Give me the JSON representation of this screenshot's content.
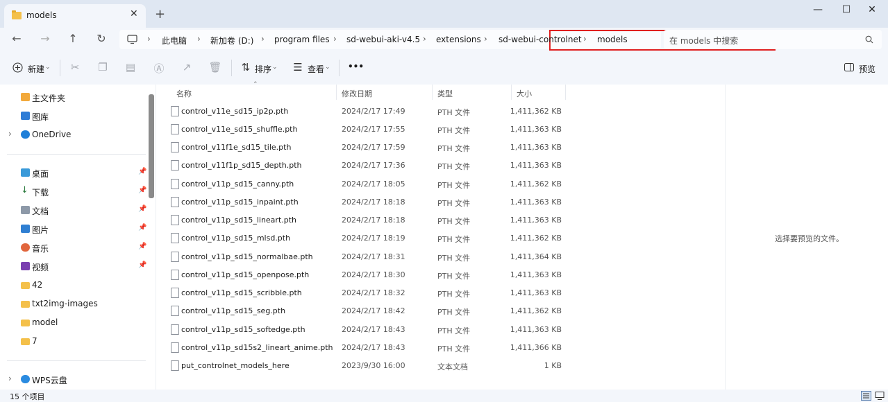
{
  "tab": {
    "title": "models",
    "close": "✕",
    "new": "+"
  },
  "window": {
    "minimize": "—",
    "maximize": "☐",
    "close": "✕"
  },
  "nav": {
    "back": "←",
    "forward": "→",
    "up": "↑",
    "refresh": "↻"
  },
  "breadcrumb": [
    "此电脑",
    "新加卷 (D:)",
    "program files",
    "sd-webui-aki-v4.5",
    "extensions",
    "sd-webui-controlnet",
    "models"
  ],
  "search": {
    "placeholder": "在 models 中搜索",
    "icon": "search-icon"
  },
  "toolbar": {
    "new_label": "新建",
    "sort_label": "排序",
    "view_label": "查看",
    "more": "•••",
    "preview_label": "预览"
  },
  "sidebar": {
    "items": [
      {
        "label": "主文件夹",
        "icon": "home-icon"
      },
      {
        "label": "图库",
        "icon": "gallery-icon"
      },
      {
        "label": "OneDrive",
        "icon": "cloud-icon"
      },
      {
        "label": "桌面",
        "icon": "desktop-icon"
      },
      {
        "label": "下载",
        "icon": "download-icon"
      },
      {
        "label": "文档",
        "icon": "document-icon"
      },
      {
        "label": "图片",
        "icon": "pictures-icon"
      },
      {
        "label": "音乐",
        "icon": "music-icon"
      },
      {
        "label": "视频",
        "icon": "video-icon"
      },
      {
        "label": "42",
        "icon": "folder-icon"
      },
      {
        "label": "txt2img-images",
        "icon": "folder-icon"
      },
      {
        "label": "model",
        "icon": "folder-icon"
      },
      {
        "label": "7",
        "icon": "folder-icon"
      },
      {
        "label": "WPS云盘",
        "icon": "cloud-icon"
      }
    ]
  },
  "columns": {
    "name": "名称",
    "modified": "修改日期",
    "type": "类型",
    "size": "大小"
  },
  "files": [
    {
      "name": "control_v11e_sd15_ip2p.pth",
      "date": "2024/2/17 17:49",
      "type": "PTH 文件",
      "size": "1,411,362 KB"
    },
    {
      "name": "control_v11e_sd15_shuffle.pth",
      "date": "2024/2/17 17:55",
      "type": "PTH 文件",
      "size": "1,411,363 KB"
    },
    {
      "name": "control_v11f1e_sd15_tile.pth",
      "date": "2024/2/17 17:59",
      "type": "PTH 文件",
      "size": "1,411,363 KB"
    },
    {
      "name": "control_v11f1p_sd15_depth.pth",
      "date": "2024/2/17 17:36",
      "type": "PTH 文件",
      "size": "1,411,363 KB"
    },
    {
      "name": "control_v11p_sd15_canny.pth",
      "date": "2024/2/17 18:05",
      "type": "PTH 文件",
      "size": "1,411,362 KB"
    },
    {
      "name": "control_v11p_sd15_inpaint.pth",
      "date": "2024/2/17 18:18",
      "type": "PTH 文件",
      "size": "1,411,363 KB"
    },
    {
      "name": "control_v11p_sd15_lineart.pth",
      "date": "2024/2/17 18:18",
      "type": "PTH 文件",
      "size": "1,411,363 KB"
    },
    {
      "name": "control_v11p_sd15_mlsd.pth",
      "date": "2024/2/17 18:19",
      "type": "PTH 文件",
      "size": "1,411,362 KB"
    },
    {
      "name": "control_v11p_sd15_normalbae.pth",
      "date": "2024/2/17 18:31",
      "type": "PTH 文件",
      "size": "1,411,364 KB"
    },
    {
      "name": "control_v11p_sd15_openpose.pth",
      "date": "2024/2/17 18:30",
      "type": "PTH 文件",
      "size": "1,411,363 KB"
    },
    {
      "name": "control_v11p_sd15_scribble.pth",
      "date": "2024/2/17 18:32",
      "type": "PTH 文件",
      "size": "1,411,363 KB"
    },
    {
      "name": "control_v11p_sd15_seg.pth",
      "date": "2024/2/17 18:42",
      "type": "PTH 文件",
      "size": "1,411,362 KB"
    },
    {
      "name": "control_v11p_sd15_softedge.pth",
      "date": "2024/2/17 18:43",
      "type": "PTH 文件",
      "size": "1,411,363 KB"
    },
    {
      "name": "control_v11p_sd15s2_lineart_anime.pth",
      "date": "2024/2/17 18:43",
      "type": "PTH 文件",
      "size": "1,411,366 KB"
    },
    {
      "name": "put_controlnet_models_here",
      "date": "2023/9/30 16:00",
      "type": "文本文档",
      "size": "1 KB"
    }
  ],
  "preview": {
    "empty_text": "选择要预览的文件。"
  },
  "status": {
    "count": "15 个项目"
  }
}
